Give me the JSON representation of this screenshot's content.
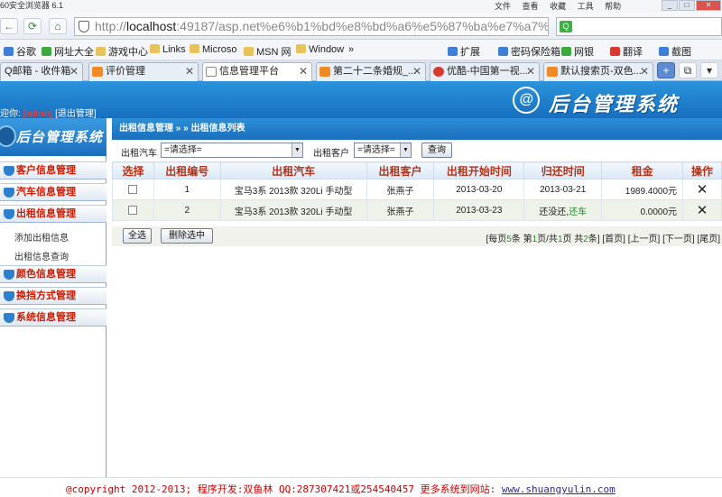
{
  "browser": {
    "title": "60安全浏览器 6.1",
    "menu": [
      "文件",
      "查看",
      "收藏",
      "工具",
      "帮助"
    ],
    "address": "http://localhost:49187/asp.net%e6%b1%bd%e8%bd%a6%e5%87%ba%e7%a7%9f",
    "address_host": "localhost",
    "bookmarks": [
      "谷歌",
      "网址大全",
      "游戏中心",
      "Links",
      "Microso",
      "MSN 网",
      "Window",
      "»",
      "扩展",
      "密码保险箱",
      "网银",
      "翻译",
      "截图"
    ],
    "tabs": [
      {
        "label": "Q邮箱 - 收件箱",
        "active": false
      },
      {
        "label": "评价管理",
        "active": false
      },
      {
        "label": "信息管理平台",
        "active": true
      },
      {
        "label": "第二十二条婚规_...",
        "active": false
      },
      {
        "label": "优酷-中国第一视...",
        "active": false
      },
      {
        "label": "默认搜索页-双色...",
        "active": false
      }
    ]
  },
  "header": {
    "welcome_prefix": "迎你:",
    "username": "[admin]",
    "logout": "[退出管理]",
    "logo_text": "后台管理系统",
    "logo_mark": "@"
  },
  "sidebar": {
    "title": "后台管理系统",
    "items": [
      {
        "label": "客户信息管理"
      },
      {
        "label": "汽车信息管理"
      },
      {
        "label": "出租信息管理"
      },
      {
        "label": "颜色信息管理"
      },
      {
        "label": "换挡方式管理"
      },
      {
        "label": "系统信息管理"
      }
    ],
    "subitems": [
      "添加出租信息",
      "出租信息查询"
    ]
  },
  "main": {
    "breadcrumb": "出租信息管理 » » 出租信息列表",
    "filters": {
      "car_label": "出租汽车",
      "car_value": "=请选择=",
      "customer_label": "出租客户",
      "customer_value": "=请选择=",
      "query_button": "查询"
    },
    "table": {
      "headers": [
        "选择",
        "出租编号",
        "出租汽车",
        "出租客户",
        "出租开始时间",
        "归还时间",
        "租金",
        "操作"
      ],
      "rows": [
        {
          "id": "1",
          "car": "宝马3系 2013款 320Li 手动型",
          "customer": "张燕子",
          "start": "2013-03-20",
          "return_time": "2013-03-21",
          "return_action": "",
          "rent": "1989.4000元"
        },
        {
          "id": "2",
          "car": "宝马3系 2013款 320Li 手动型",
          "customer": "张燕子",
          "start": "2013-03-23",
          "return_time": "还没还,",
          "return_action": "还车",
          "rent": "0.0000元"
        }
      ]
    },
    "select_all": "全选",
    "delete_selected": "删除选中",
    "pager": {
      "per_page_prefix": "[每页",
      "per_page": "5",
      "per_page_suffix": "条 第",
      "current": "1",
      "sep": "页/共",
      "total_pages": "1",
      "total_suffix": "页 共",
      "total_items": "2",
      "items_suffix": "条]",
      "first": "[首页]",
      "prev": "[上一页]",
      "next": "[下一页]",
      "last": "[尾页]"
    }
  },
  "footer": {
    "text": "@copyright 2012-2013; 程序开发:双鱼林  QQ:287307421或254540457  更多系统到网站: ",
    "url": "www.shuangyulin.com"
  }
}
